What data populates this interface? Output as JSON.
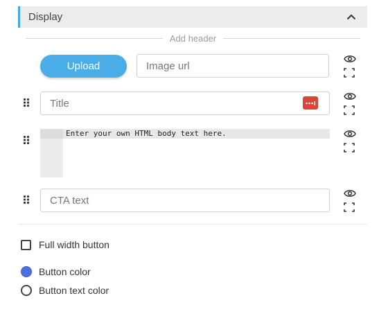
{
  "section": {
    "title": "Display"
  },
  "divider": {
    "label": "Add header"
  },
  "upload": {
    "label": "Upload"
  },
  "image_url": {
    "placeholder": "Image url",
    "value": ""
  },
  "title_field": {
    "placeholder": "Title",
    "value": ""
  },
  "body_editor": {
    "text": "Enter your own HTML body text here."
  },
  "cta_field": {
    "placeholder": "CTA text",
    "value": ""
  },
  "options": {
    "full_width": {
      "label": "Full width button",
      "checked": false
    },
    "button_color": {
      "label": "Button color",
      "color": "#4a6fe0"
    },
    "button_text_color": {
      "label": "Button text color",
      "color": "#ffffff"
    }
  },
  "colors": {
    "accent": "#4bade8",
    "header_bar": "#3fa9e6",
    "password_manager": "#d9453a"
  },
  "icons": {
    "collapse": "chevron-up-icon",
    "visibility": "eye-icon",
    "fullscreen": "expand-icon",
    "drag": "drag-handle-icon",
    "password_manager": "password-key-icon"
  }
}
